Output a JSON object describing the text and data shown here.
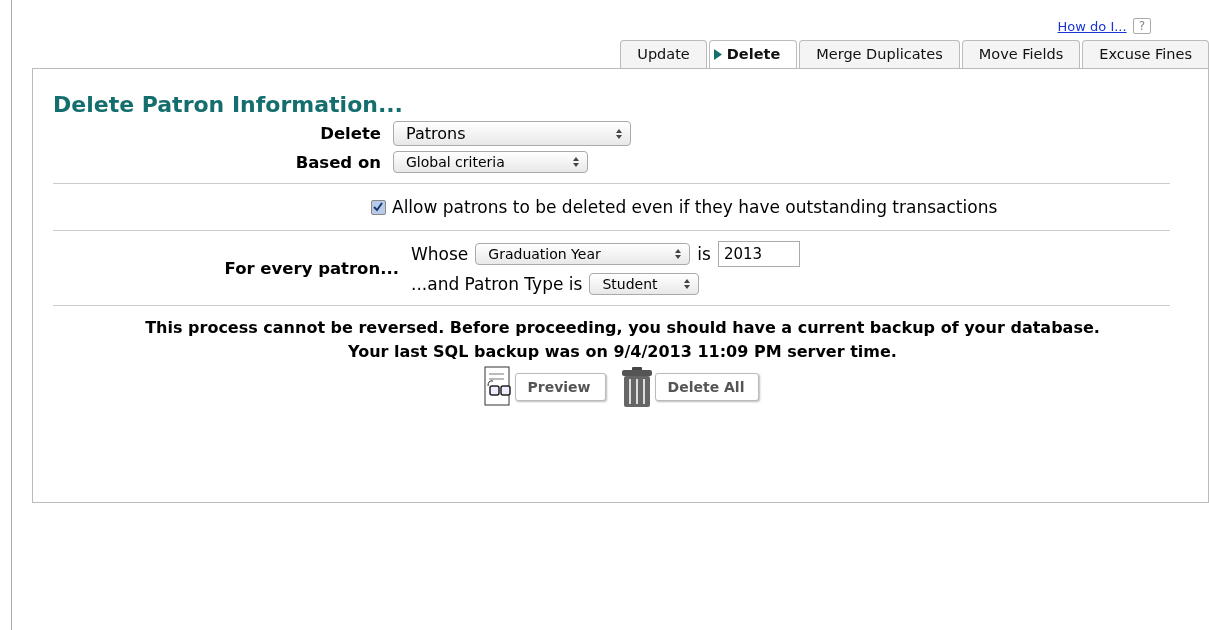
{
  "help": {
    "link": "How do I...",
    "icon": "?"
  },
  "tabs": [
    {
      "label": "Update",
      "selected": false
    },
    {
      "label": "Delete",
      "selected": true
    },
    {
      "label": "Merge Duplicates",
      "selected": false
    },
    {
      "label": "Move Fields",
      "selected": false
    },
    {
      "label": "Excuse Fines",
      "selected": false
    }
  ],
  "heading": "Delete Patron Information...",
  "delete": {
    "label": "Delete",
    "value": "Patrons"
  },
  "based_on": {
    "label": "Based on",
    "value": "Global criteria"
  },
  "allow": {
    "label": "Allow patrons to be deleted even if they have outstanding transactions",
    "checked": true
  },
  "criteria": {
    "label": "For every patron...",
    "whose": "Whose",
    "field": "Graduation Year",
    "is": "is",
    "year": "2013",
    "type_label": "...and Patron Type is",
    "type": "Student"
  },
  "warning": [
    "This process cannot be reversed. Before proceeding, you should have a current backup of your database.",
    "Your last SQL backup was on 9/4/2013 11:09 PM server time."
  ],
  "buttons": [
    {
      "kind": "preview",
      "label": "Preview"
    },
    {
      "kind": "delete",
      "label": "Delete All"
    }
  ]
}
